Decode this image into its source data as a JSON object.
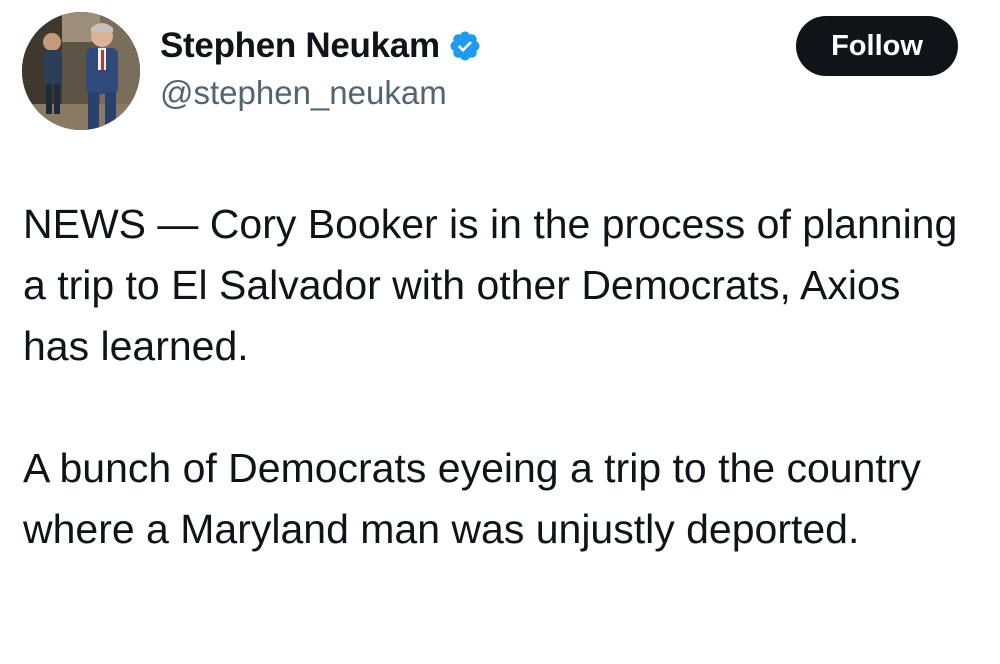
{
  "author": {
    "display_name": "Stephen Neukam",
    "handle": "@stephen_neukam",
    "verified": true,
    "verified_icon": "verified-badge-icon",
    "verified_color": "#1d9bf0"
  },
  "follow_button": {
    "label": "Follow",
    "background": "#0f1419",
    "text_color": "#ffffff"
  },
  "tweet": {
    "paragraphs": [
      "NEWS — Cory Booker is in the process of planning a trip to El Salvador with other Democrats, Axios has learned.",
      "A bunch of Democrats eyeing a trip to the country where a Maryland man was unjustly deported."
    ]
  },
  "colors": {
    "text_primary": "#0f1419",
    "text_secondary": "#536471"
  }
}
